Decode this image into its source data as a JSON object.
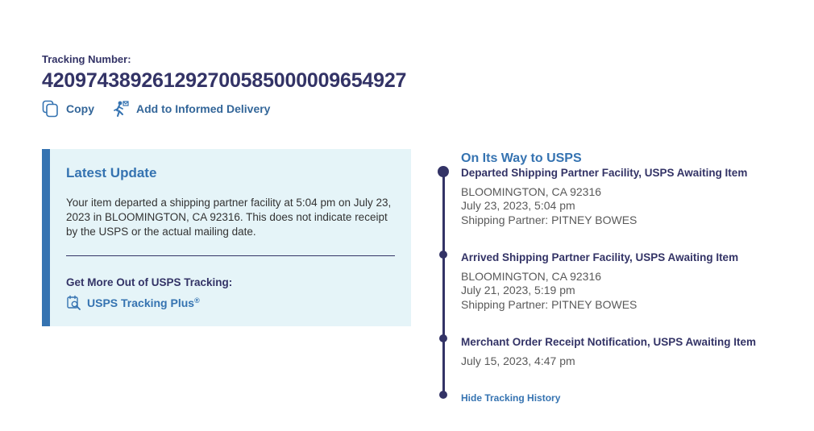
{
  "tracking": {
    "label": "Tracking Number:",
    "number": "420974389261292700585000009654927"
  },
  "actions": {
    "copy_label": "Copy",
    "informed_delivery_label": "Add to Informed Delivery"
  },
  "latest_update": {
    "title": "Latest Update",
    "text": "Your item departed a shipping partner facility at 5:04 pm on July 23, 2023 in BLOOMINGTON, CA 92316. This does not indicate receipt by the USPS or the actual mailing date.",
    "more_label": "Get More Out of USPS Tracking:",
    "plus_link": "USPS Tracking Plus",
    "plus_mark": "®"
  },
  "timeline": {
    "status_heading": "On Its Way to USPS",
    "events": [
      {
        "title": "Departed Shipping Partner Facility, USPS Awaiting Item",
        "location": "BLOOMINGTON, CA 92316",
        "datetime": "July 23, 2023, 5:04 pm",
        "partner": "Shipping Partner: PITNEY BOWES"
      },
      {
        "title": "Arrived Shipping Partner Facility, USPS Awaiting Item",
        "location": "BLOOMINGTON, CA 92316",
        "datetime": "July 21, 2023, 5:19 pm",
        "partner": "Shipping Partner: PITNEY BOWES"
      },
      {
        "title": "Merchant Order Receipt Notification, USPS Awaiting Item",
        "datetime": "July 15, 2023, 4:47 pm"
      }
    ],
    "hide_link": "Hide Tracking History"
  },
  "colors": {
    "navy": "#333366",
    "link_blue": "#3573b1",
    "panel_bg": "#e5f4f8"
  },
  "icons": [
    "copy-icon",
    "informed-delivery-icon",
    "tracking-plus-icon"
  ]
}
